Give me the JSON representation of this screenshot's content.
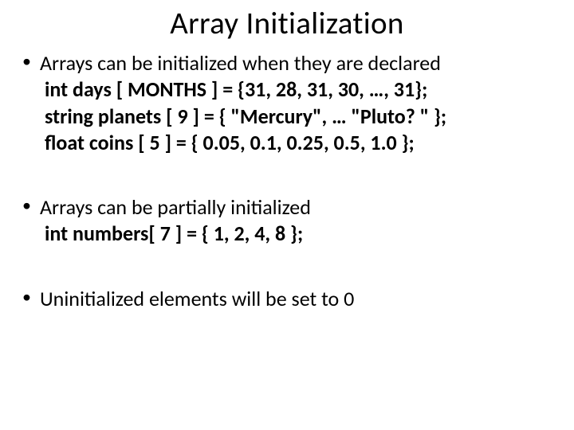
{
  "title": "Array Initialization",
  "bullets": [
    {
      "lead": "Arrays can be initialized when they are declared",
      "subs": [
        "int days [ MONTHS ] = {31, 28, 31, 30, …, 31};",
        "string planets [ 9 ] = { \"Mercury\", … \"Pluto? \" };",
        "float coins [ 5 ] = { 0.05, 0.1, 0.25, 0.5, 1.0 };"
      ]
    },
    {
      "lead": "Arrays can be partially initialized",
      "subs": [
        "int numbers[ 7 ] = { 1, 2, 4, 8 };"
      ]
    },
    {
      "lead": "Uninitialized elements will be set to 0",
      "subs": []
    }
  ]
}
